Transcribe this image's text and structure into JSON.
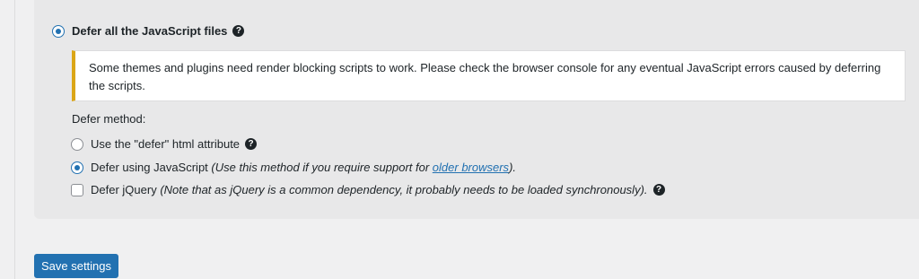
{
  "main_option": {
    "label": "Defer all the JavaScript files",
    "checked": true,
    "help_icon": "question-circle-icon"
  },
  "notice": {
    "text": "Some themes and plugins need render blocking scripts to work. Please check the browser console for any eventual JavaScript errors caused by deferring the scripts.",
    "accent_color": "#dba617"
  },
  "defer_method": {
    "label": "Defer method:",
    "options": [
      {
        "label": "Use the \"defer\" html attribute",
        "checked": false,
        "help_icon": "question-circle-icon"
      },
      {
        "label": "Defer using JavaScript",
        "note_prefix": "(Use this method if you require support for ",
        "link_text": "older browsers",
        "note_suffix": ").",
        "checked": true
      }
    ]
  },
  "defer_jquery": {
    "label": "Defer jQuery",
    "note": "(Note that as jQuery is a common dependency, it probably needs to be loaded synchronously).",
    "checked": false,
    "help_icon": "question-circle-icon"
  },
  "save_button": {
    "label": "Save settings"
  },
  "colors": {
    "accent": "#2271b1",
    "panel_bg": "#e8e8e9",
    "page_bg": "#f0f0f1"
  }
}
